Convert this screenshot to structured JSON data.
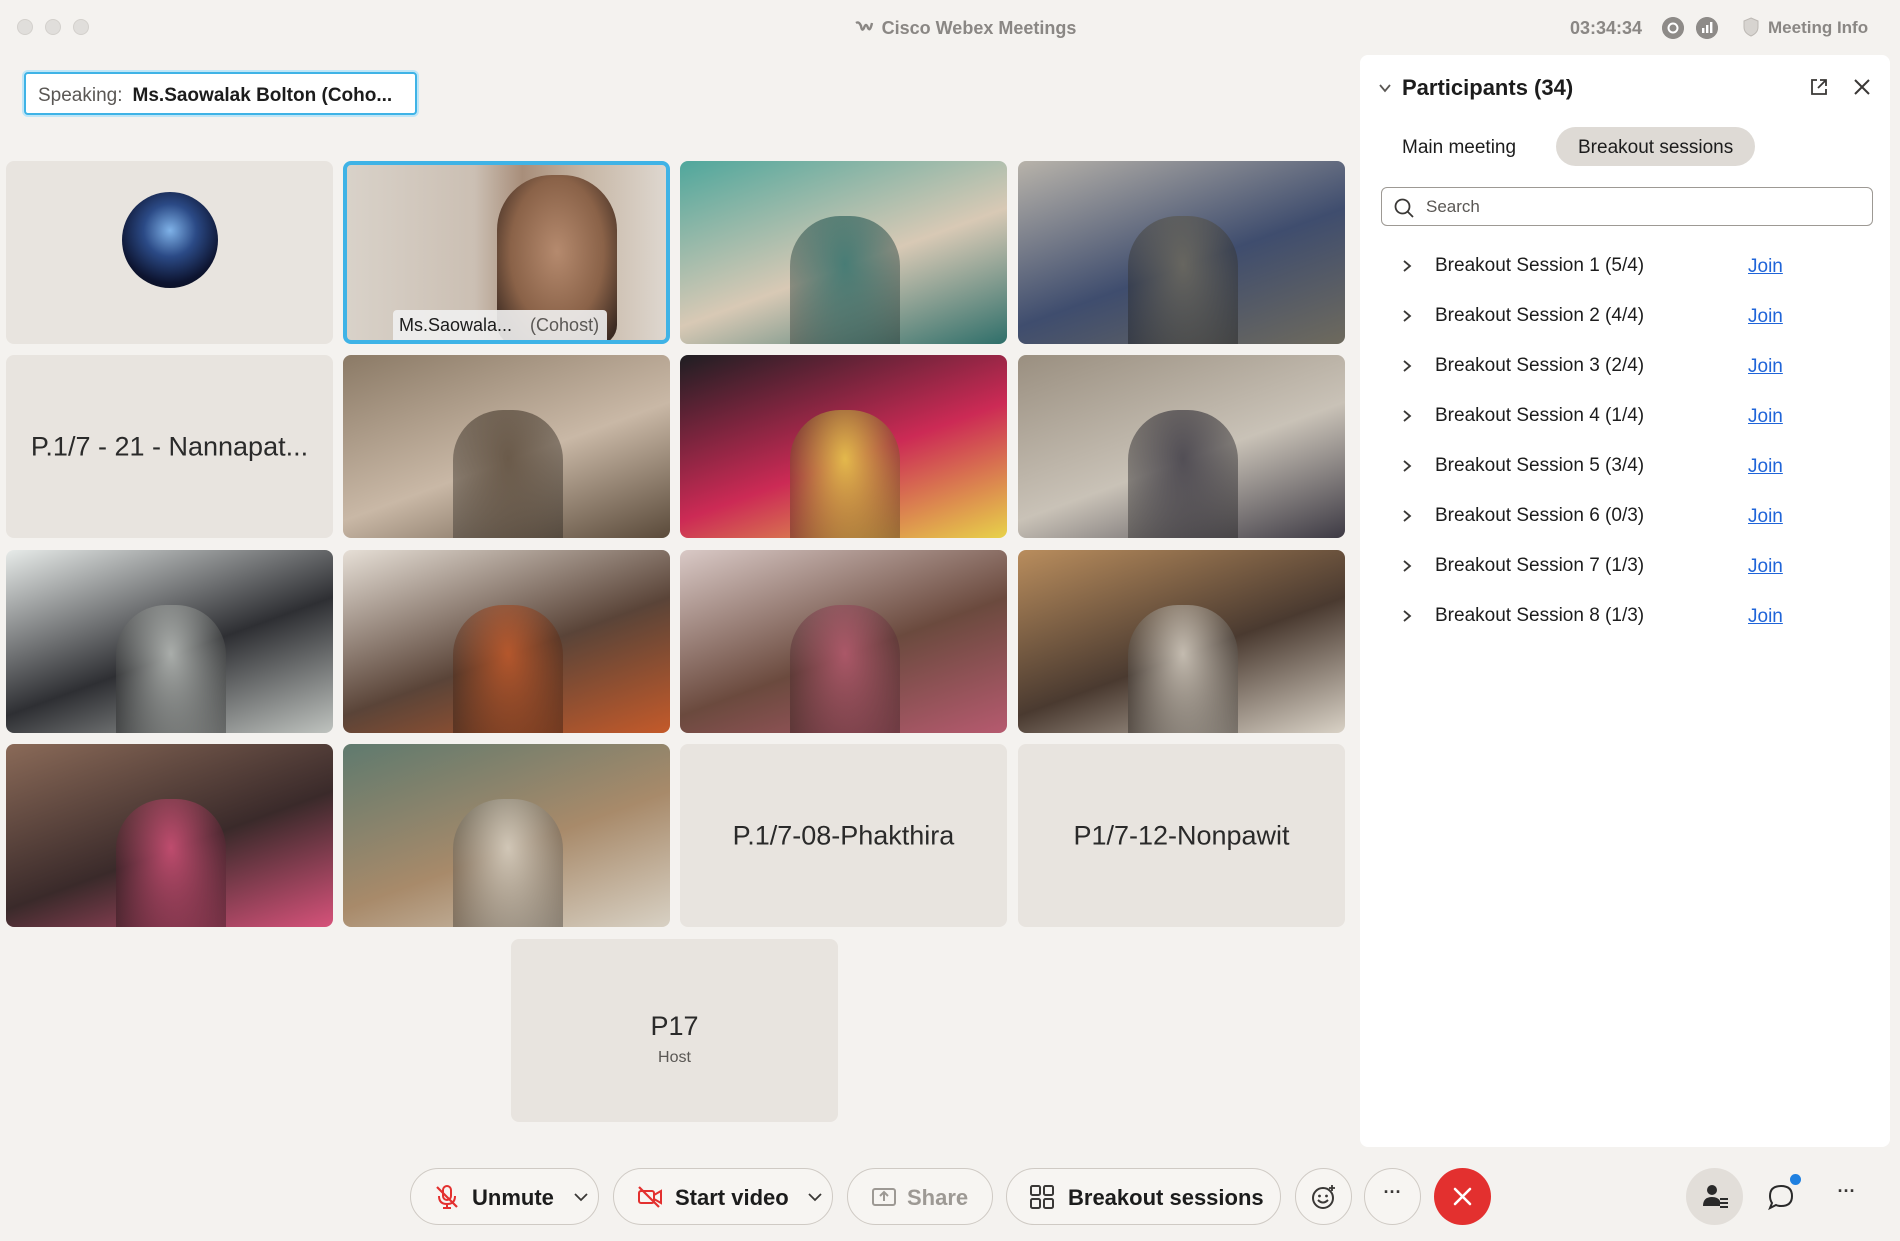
{
  "window": {
    "app_title": "Cisco Webex Meetings",
    "clock": "03:34:34",
    "meeting_info_label": "Meeting Info"
  },
  "speaking": {
    "label": "Speaking:",
    "name": "Ms.Saowalak Bolton (Coho..."
  },
  "tiles": [
    {
      "type": "avatar"
    },
    {
      "type": "video",
      "name": "Ms.Saowala...",
      "role": "(Cohost)",
      "active": true
    },
    {
      "type": "video",
      "colors": [
        "#4fa79c",
        "#2f6f6a",
        "#d8c9b5"
      ]
    },
    {
      "type": "video",
      "colors": [
        "#b8b3aa",
        "#6e6a5d",
        "#3f4d6e"
      ]
    },
    {
      "type": "placeholder",
      "name": "P.1/7 - 21 - Nannapat..."
    },
    {
      "type": "video",
      "colors": [
        "#8b7a66",
        "#5a4a3a",
        "#c9b8a6"
      ]
    },
    {
      "type": "video",
      "colors": [
        "#1e1e22",
        "#e8d24a",
        "#cc2a55"
      ]
    },
    {
      "type": "video",
      "colors": [
        "#9a8f80",
        "#3d3a44",
        "#c9c2b7"
      ]
    },
    {
      "type": "video",
      "colors": [
        "#e7ebe9",
        "#bfc3bf",
        "#2e2f33"
      ]
    },
    {
      "type": "video",
      "colors": [
        "#e6dfd6",
        "#c45a2a",
        "#5a4438"
      ]
    },
    {
      "type": "video",
      "colors": [
        "#d9c9c6",
        "#b65a6f",
        "#6b4a3e"
      ]
    },
    {
      "type": "video",
      "colors": [
        "#b98d5d",
        "#d9d2c6",
        "#4a3a30"
      ]
    },
    {
      "type": "video",
      "colors": [
        "#8a6a58",
        "#d6527a",
        "#3a2a2a"
      ]
    },
    {
      "type": "video",
      "colors": [
        "#5f7a6e",
        "#d8d1c4",
        "#a88a6a"
      ]
    },
    {
      "type": "placeholder",
      "name": "P.1/7-08-Phakthira"
    },
    {
      "type": "placeholder",
      "name": "P1/7-12-Nonpawit"
    }
  ],
  "host_tile": {
    "name": "P17",
    "role": "Host"
  },
  "participants": {
    "title": "Participants (34)",
    "tabs": {
      "main": "Main meeting",
      "breakout": "Breakout sessions"
    },
    "search_placeholder": "Search",
    "join_label": "Join",
    "sessions": [
      {
        "label": "Breakout Session 1 (5/4)"
      },
      {
        "label": "Breakout Session 2 (4/4)"
      },
      {
        "label": "Breakout Session 3 (2/4)"
      },
      {
        "label": "Breakout Session 4 (1/4)"
      },
      {
        "label": "Breakout Session 5 (3/4)"
      },
      {
        "label": "Breakout Session 6 (0/3)"
      },
      {
        "label": "Breakout Session 7 (1/3)"
      },
      {
        "label": "Breakout Session 8 (1/3)"
      }
    ]
  },
  "controls": {
    "unmute": "Unmute",
    "start_video": "Start video",
    "share": "Share",
    "breakout_sessions": "Breakout sessions",
    "more": "···"
  },
  "colors": {
    "accent": "#3fb3e6",
    "link": "#1f64d8",
    "end_call": "#e3302f",
    "mute_red": "#e3302f"
  }
}
